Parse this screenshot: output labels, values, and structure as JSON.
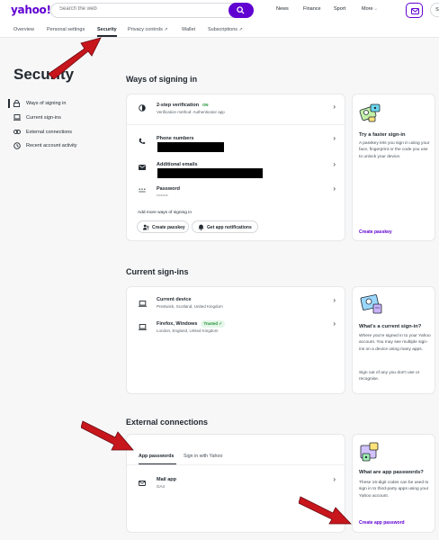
{
  "header": {
    "logo": "yahoo!",
    "search_placeholder": "Search the web",
    "nav": [
      "News",
      "Finance",
      "Sport",
      "More"
    ],
    "user_initial": "S"
  },
  "tabs": [
    {
      "label": "Overview"
    },
    {
      "label": "Personal settings"
    },
    {
      "label": "Security"
    },
    {
      "label": "Privacy controls"
    },
    {
      "label": "Wallet"
    },
    {
      "label": "Subscriptions"
    }
  ],
  "page_title": "Security",
  "sidenav": [
    {
      "label": "Ways of signing in",
      "icon": "lock-icon"
    },
    {
      "label": "Current sign-ins",
      "icon": "laptop-icon"
    },
    {
      "label": "External connections",
      "icon": "link-icon"
    },
    {
      "label": "Recent account activity",
      "icon": "clock-icon"
    }
  ],
  "signin": {
    "title": "Ways of signing in",
    "two_step": {
      "title": "2-step verification",
      "status": "ON",
      "sub": "Verification method: Authenticator app"
    },
    "phone": {
      "title": "Phone numbers"
    },
    "email": {
      "title": "Additional emails"
    },
    "password": {
      "title": "Password",
      "masked": "••••••••"
    },
    "add_more": "Add more ways of signing in",
    "create_passkey": "Create passkey",
    "app_notifications": "Get app notifications"
  },
  "signin_info": {
    "title": "Try a faster sign-in",
    "text": "A passkey lets you sign in using your face, fingerprint or the code you use to unlock your device.",
    "link": "Create passkey"
  },
  "current": {
    "title": "Current sign-ins",
    "devices": [
      {
        "name": "Current device",
        "location": "Prestwick, Scotland, United Kingdom"
      },
      {
        "name": "Firefox, Windows",
        "badge": "Trusted",
        "location": "London, England, United Kingdom"
      }
    ]
  },
  "current_info": {
    "title": "What's a current sign-in?",
    "text1": "Where you're signed in to your Yahoo account. You may see multiple sign-ins on a device using many apps.",
    "text2": "Sign out of any you don't use or recognise."
  },
  "external": {
    "title": "External connections",
    "tabs": [
      "App passwords",
      "Sign in with Yahoo"
    ],
    "app": {
      "name": "Mail app",
      "sub": "GA4"
    }
  },
  "external_info": {
    "title": "What are app passwords?",
    "text": "These 16-digit codes can be used to sign in to third-party apps using your Yahoo account.",
    "link": "Create app password"
  },
  "colors": {
    "brand": "#6001d2",
    "arrow": "#c8161d",
    "on": "#1a8e2f"
  }
}
